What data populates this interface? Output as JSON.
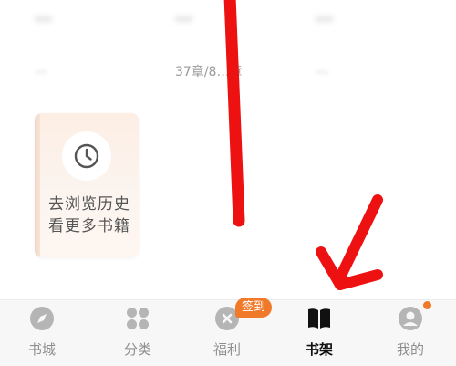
{
  "books": [
    {
      "title": "…",
      "meta": "…"
    },
    {
      "title": "…",
      "meta": "37章/8…章"
    },
    {
      "title": "…",
      "meta": "…"
    }
  ],
  "history_card": {
    "line1": "去浏览历史",
    "line2": "看更多书籍",
    "icon": "clock-icon"
  },
  "tabbar": {
    "tabs": [
      {
        "label": "书城",
        "icon": "compass-icon",
        "active": false
      },
      {
        "label": "分类",
        "icon": "grid-icon",
        "active": false
      },
      {
        "label": "福利",
        "icon": "gift-icon",
        "active": false
      },
      {
        "label": "书架",
        "icon": "book-icon",
        "active": true
      },
      {
        "label": "我的",
        "icon": "profile-icon",
        "active": false
      }
    ],
    "badge": "签到"
  },
  "colors": {
    "accent": "#f07a2a",
    "annotation": "#ee1111",
    "tabbar_bg": "#f7f7f7",
    "inactive_tab": "#8f8f8f"
  }
}
